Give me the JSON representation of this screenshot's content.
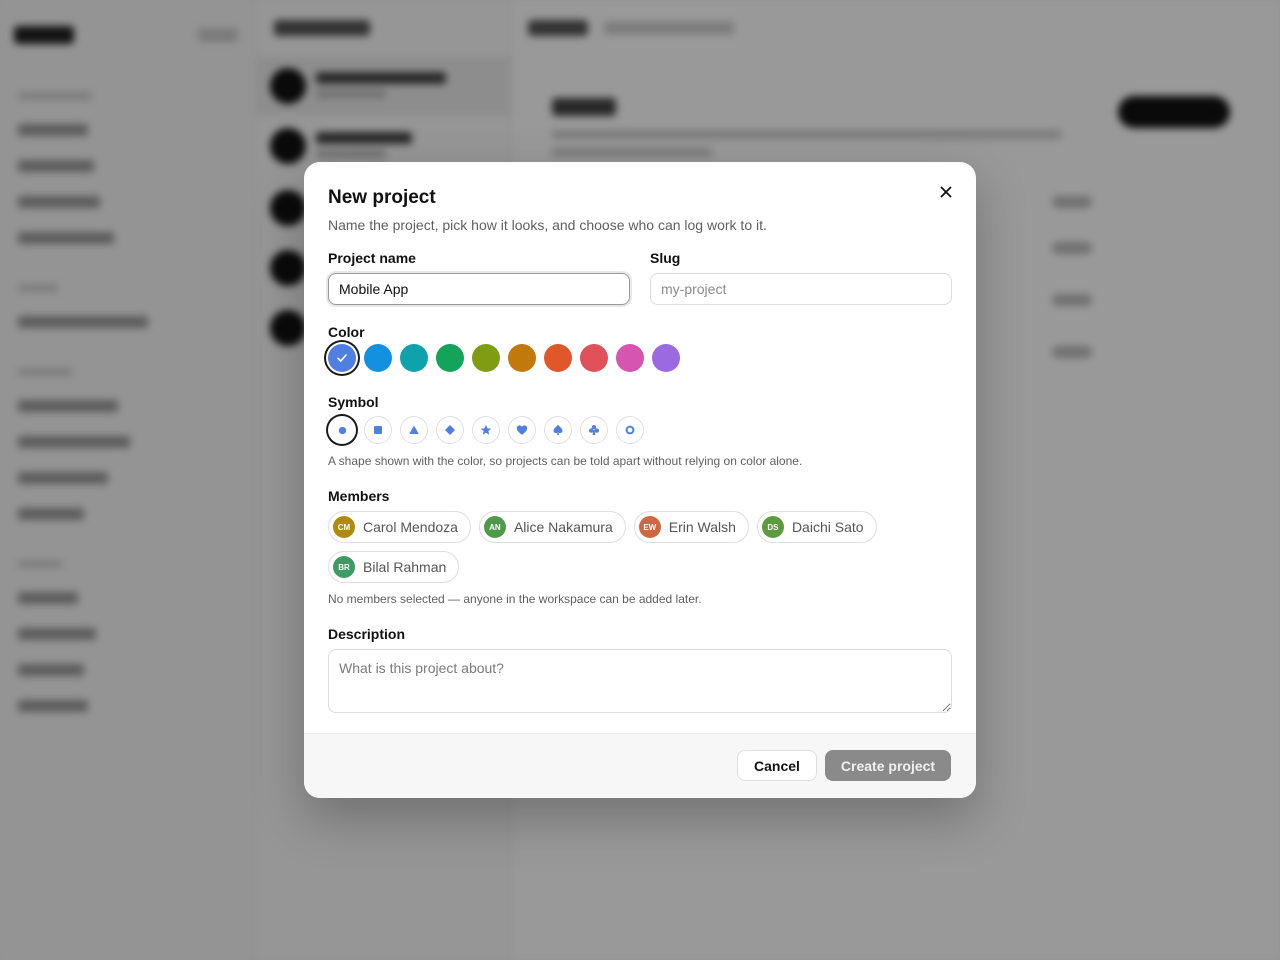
{
  "modal": {
    "title": "New project",
    "subtitle": "Name the project, pick how it looks, and choose who can log work to it.",
    "close_icon": "close-icon"
  },
  "fields": {
    "name_label": "Project name",
    "name_value": "Mobile App",
    "slug_label": "Slug",
    "slug_placeholder": "my-project",
    "color_label": "Color",
    "symbol_label": "Symbol",
    "symbol_hint": "A shape shown with the color, so projects can be told apart without relying on color alone.",
    "members_label": "Members",
    "members_hint": "No members selected — anyone in the workspace can be added later.",
    "description_label": "Description",
    "description_placeholder": "What is this project about?"
  },
  "colors": {
    "selected_index": 0,
    "swatches": [
      "#4f7fe0",
      "#1391e0",
      "#0ea2ad",
      "#13a35a",
      "#7f9c13",
      "#c17a0a",
      "#e0572b",
      "#e05159",
      "#d555b0",
      "#9b6ae0"
    ]
  },
  "symbols": {
    "selected_index": 0,
    "color": "#4f7fe0",
    "items": [
      "circle-icon",
      "square-icon",
      "triangle-icon",
      "diamond-icon",
      "star-icon",
      "heart-icon",
      "spade-icon",
      "club-icon",
      "ring-icon"
    ]
  },
  "members": [
    {
      "initials": "CM",
      "name": "Carol Mendoza",
      "color": "#b08a0a"
    },
    {
      "initials": "AN",
      "name": "Alice Nakamura",
      "color": "#4f9a4a"
    },
    {
      "initials": "EW",
      "name": "Erin Walsh",
      "color": "#d0683f"
    },
    {
      "initials": "DS",
      "name": "Daichi Sato",
      "color": "#5e9a3f"
    },
    {
      "initials": "BR",
      "name": "Bilal Rahman",
      "color": "#3f9a63"
    }
  ],
  "footer": {
    "cancel_label": "Cancel",
    "create_label": "Create project"
  }
}
